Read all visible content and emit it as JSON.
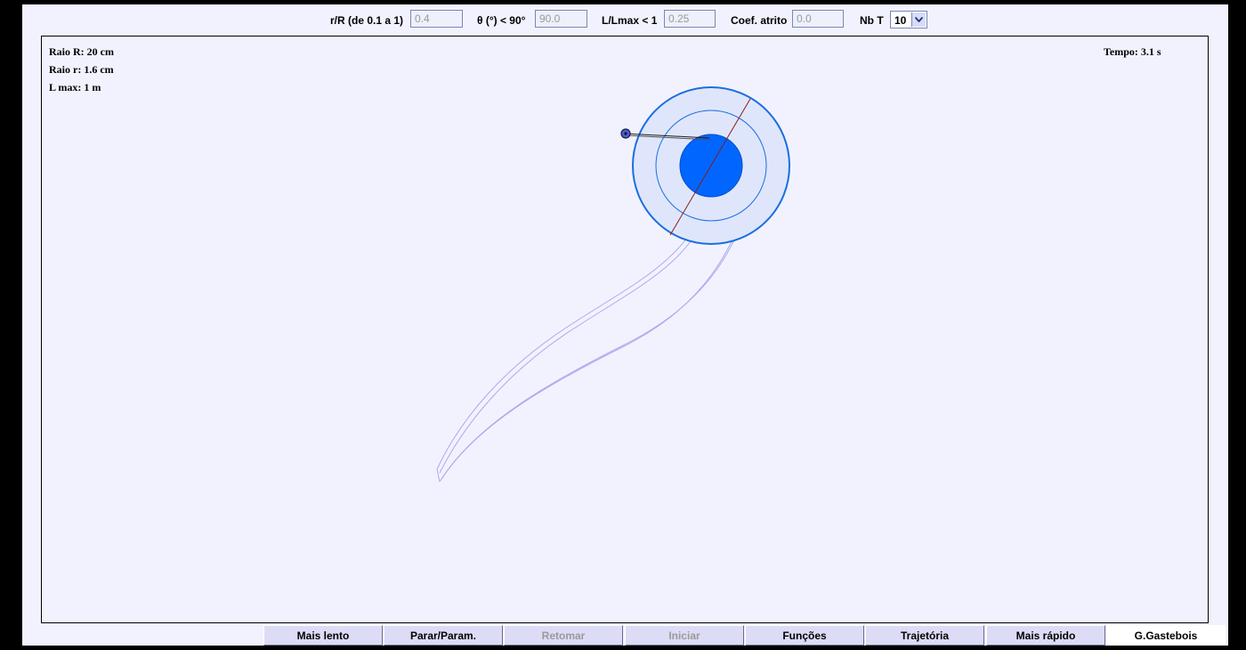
{
  "toolbar": {
    "params": [
      {
        "label": "r/R (de 0.1 a 1)",
        "value": "0.4"
      },
      {
        "label": "θ (°) < 90°",
        "value": "90.0"
      },
      {
        "label": "L/Lmax < 1",
        "value": "0.25"
      },
      {
        "label": "Coef. atrito",
        "value": "0.0"
      }
    ],
    "nbt": {
      "label": "Nb T",
      "value": "10"
    }
  },
  "info": {
    "raio_R": "Raio R: 20 cm",
    "raio_r": "Raio r: 1.6 cm",
    "l_max": "L max: 1 m",
    "tempo": "Tempo: 3.1 s"
  },
  "buttons": [
    {
      "label": "Mais lento",
      "enabled": true
    },
    {
      "label": "Parar/Param.",
      "enabled": true
    },
    {
      "label": "Retomar",
      "enabled": false
    },
    {
      "label": "Iniciar",
      "enabled": false
    },
    {
      "label": "Funções",
      "enabled": true
    },
    {
      "label": "Trajetória",
      "enabled": true
    },
    {
      "label": "Mais rápido",
      "enabled": true
    },
    {
      "label": "G.Gastebois",
      "enabled": true
    }
  ],
  "colors": {
    "background": "#f2f2ff",
    "wheel_fill": "#0066ff",
    "wheel_ring": "#1a6fe0",
    "trajectory": "#aaaaee",
    "spoke": "#8b1a1a"
  },
  "icons": {
    "select_arrow": "chevron-down-icon"
  }
}
